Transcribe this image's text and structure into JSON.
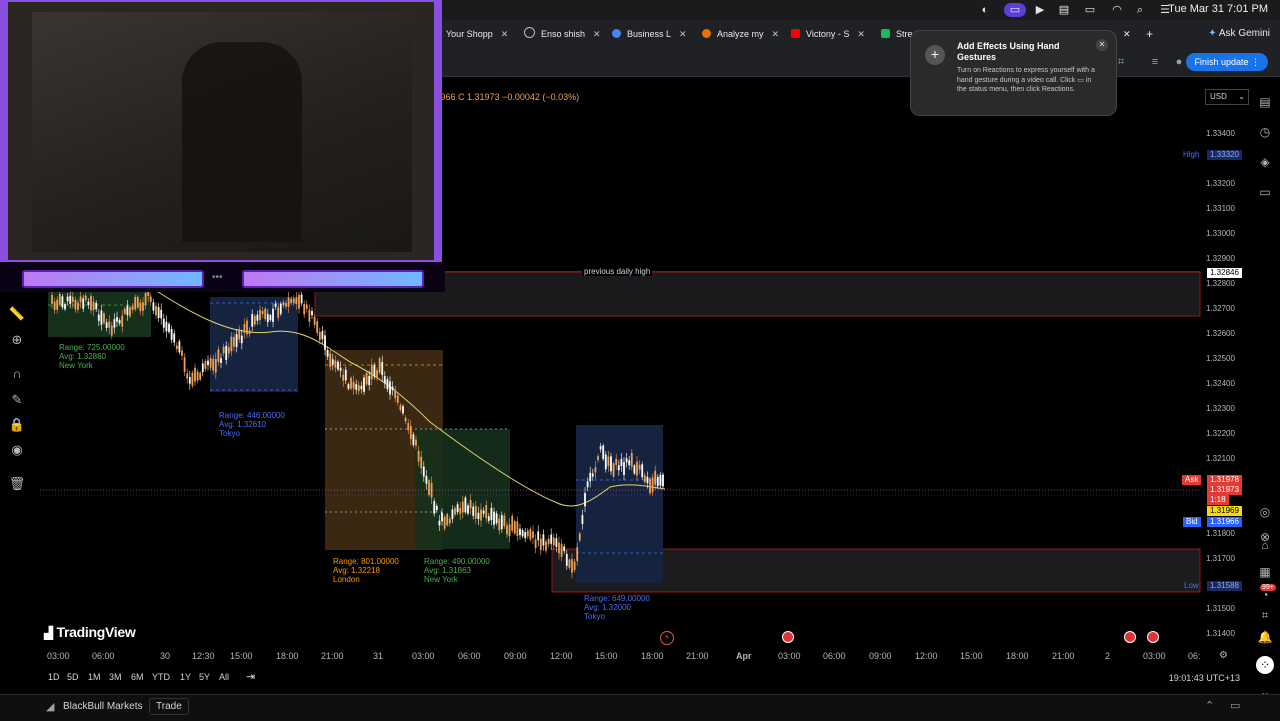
{
  "menubar": {
    "clock": "Tue Mar 31  7:01 PM"
  },
  "browser": {
    "tabs": [
      {
        "label": "Your Shopp",
        "color": "#5f6368"
      },
      {
        "label": "Enso shish",
        "color": "#202124"
      },
      {
        "label": "Business L",
        "color": "#4285f4"
      },
      {
        "label": "Analyze my",
        "color": "#e8710a"
      },
      {
        "label": "Victony - S",
        "color": "#ff0000"
      },
      {
        "label": "Stre",
        "color": "#1db954"
      }
    ],
    "ask_gemini": "Ask Gemini",
    "finish_update": "Finish update"
  },
  "popup": {
    "title": "Add Effects Using Hand Gestures",
    "body": "Turn on Reactions to express yourself with a hand gesture during a video call. Click ▭ in the status menu, then click Reactions."
  },
  "chart": {
    "ohlc": ".31966  C 1.31973  −0.00042 (−0.03%)",
    "currency": "USD",
    "price_ticks": [
      "1.33400",
      "1.33200",
      "1.33100",
      "1.33000",
      "1.32900",
      "1.32800",
      "1.32700",
      "1.32600",
      "1.32500",
      "1.32400",
      "1.32300",
      "1.32200",
      "1.32100",
      "1.31800",
      "1.31700",
      "1.31500",
      "1.31400"
    ],
    "high_tag": {
      "label": "High",
      "value": "1.33320"
    },
    "prev_high_tag": "1.32846",
    "ask_tag": {
      "label": "Ask",
      "value": "1.31978"
    },
    "last_tag": "1.31973",
    "countdown": "1:18",
    "yellow_tag": "1.31969",
    "bid_tag": {
      "label": "Bid",
      "value": "1.31966"
    },
    "low_tag": {
      "label": "Low",
      "value": "1.31588"
    },
    "previous_daily_high": "previous daily high",
    "time_ticks": [
      "03:00",
      "06:00",
      "30",
      "12:30",
      "15:00",
      "18:00",
      "21:00",
      "31",
      "03:00",
      "06:00",
      "09:00",
      "12:00",
      "15:00",
      "18:00",
      "21:00",
      "Apr",
      "03:00",
      "06:00",
      "09:00",
      "12:00",
      "15:00",
      "18:00",
      "21:00",
      "2",
      "03:00",
      "06:"
    ],
    "sessions": [
      {
        "range": "Range: 725.00000",
        "avg": "Avg: 1.32860",
        "name": "New York",
        "color": "#4caf50"
      },
      {
        "range": "Range: 446.00000",
        "avg": "Avg: 1.32610",
        "name": "Tokyo",
        "color": "#4a6cf7"
      },
      {
        "range": "Range: 801.00000",
        "avg": "Avg: 1.32218",
        "name": "London",
        "color": "#ff9800"
      },
      {
        "range": "Range: 490.00000",
        "avg": "Avg: 1.31863",
        "name": "New York",
        "color": "#4caf50"
      },
      {
        "range": "Range: 649.00000",
        "avg": "Avg: 1.32000",
        "name": "Tokyo",
        "color": "#4a6cf7"
      }
    ],
    "range_buttons": [
      "1D",
      "5D",
      "1M",
      "3M",
      "6M",
      "YTD",
      "1Y",
      "5Y",
      "All"
    ],
    "utc": "19:01:43 UTC+13",
    "logo": "TradingView",
    "notif_badge": "99+"
  },
  "bottom": {
    "broker": "BlackBull Markets",
    "trade": "Trade"
  }
}
